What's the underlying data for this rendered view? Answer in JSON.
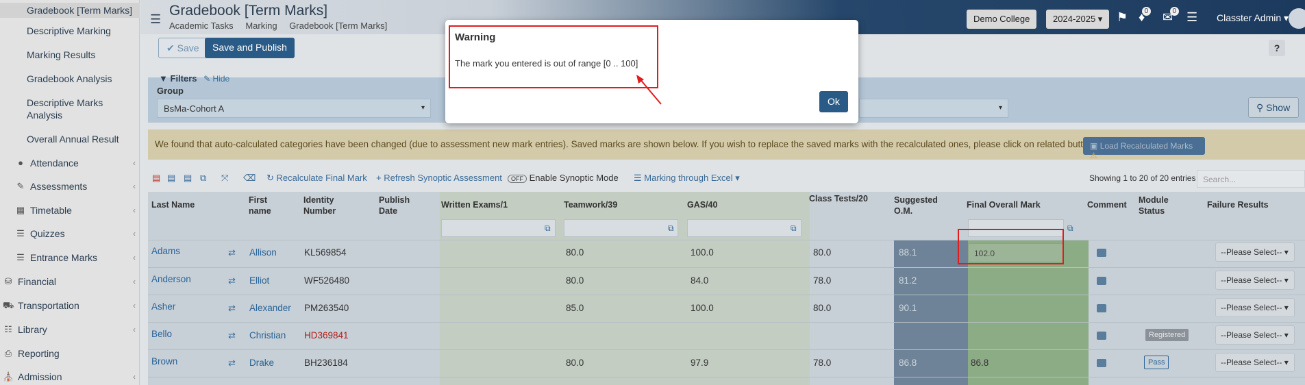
{
  "sidebar": {
    "sub_items": [
      {
        "label": "Gradebook [Term Marks]",
        "active": true
      },
      {
        "label": "Descriptive Marking"
      },
      {
        "label": "Marking Results"
      },
      {
        "label": "Gradebook Analysis"
      },
      {
        "label": "Descriptive Marks Analysis"
      },
      {
        "label": "Overall Annual Result"
      }
    ],
    "items": [
      {
        "label": "Attendance",
        "icon": "user-icon"
      },
      {
        "label": "Assessments",
        "icon": "pencil-icon"
      },
      {
        "label": "Timetable",
        "icon": "calendar-icon"
      },
      {
        "label": "Quizzes",
        "icon": "list-icon"
      },
      {
        "label": "Entrance Marks",
        "icon": "list-icon"
      },
      {
        "label": "Financial",
        "icon": "coins-icon"
      },
      {
        "label": "Transportation",
        "icon": "car-icon"
      },
      {
        "label": "Library",
        "icon": "books-icon"
      },
      {
        "label": "Reporting",
        "icon": "print-icon"
      },
      {
        "label": "Admission",
        "icon": "building-icon"
      }
    ]
  },
  "header": {
    "title": "Gradebook [Term Marks]",
    "breadcrumbs": [
      "Academic Tasks",
      "Marking",
      "Gradebook [Term Marks]"
    ],
    "college": "Demo College",
    "year": "2024-2025",
    "notif_count": "0",
    "mail_count": "0",
    "user": "Classter Admin"
  },
  "toolbar": {
    "save_label": "Save",
    "publish_label": "Save and Publish",
    "help": "?"
  },
  "filters": {
    "title": "Filters",
    "hide": "Hide",
    "group_label": "Group",
    "group_value": "BsMa-Cohort A",
    "show_label": "Show"
  },
  "alert": {
    "text": "We found that auto-calculated categories have been changed (due to assessment new mark entries). Saved marks are shown below. If you wish to replace the saved marks with the recalculated ones, please click on related button.",
    "button": "Load Recalculated Marks"
  },
  "table_toolbar": {
    "recalc": "Recalculate Final Mark",
    "refresh": "Refresh Synoptic Assessment",
    "toggle": "OFF",
    "synoptic": "Enable Synoptic Mode",
    "excel": "Marking through Excel",
    "showing": "Showing 1 to 20 of 20 entries",
    "search_placeholder": "Search..."
  },
  "table": {
    "headers": {
      "last": "Last Name",
      "first": "First name",
      "identity": "Identity Number",
      "publish": "Publish Date",
      "written": "Written Exams/1",
      "teamwork": "Teamwork/39",
      "gas": "GAS/40",
      "class_tests": "Class Tests/20",
      "suggested": "Suggested O.M.",
      "final": "Final Overall Mark",
      "comment": "Comment",
      "module": "Module Status",
      "failure": "Failure Results"
    },
    "rows": [
      {
        "last": "Adams",
        "first": "Allison",
        "id": "KL569854",
        "teamwork": "80.0",
        "gas": "100.0",
        "class_tests": "80.0",
        "suggested": "88.1",
        "final": "102.0",
        "module": "",
        "failure": "--Please Select--"
      },
      {
        "last": "Anderson",
        "first": "Elliot",
        "id": "WF526480",
        "teamwork": "80.0",
        "gas": "84.0",
        "class_tests": "78.0",
        "suggested": "81.2",
        "final": "",
        "module": "",
        "failure": "--Please Select--"
      },
      {
        "last": "Asher",
        "first": "Alexander",
        "id": "PM263540",
        "teamwork": "85.0",
        "gas": "100.0",
        "class_tests": "80.0",
        "suggested": "90.1",
        "final": "",
        "module": "",
        "failure": "--Please Select--"
      },
      {
        "last": "Bello",
        "first": "Christian",
        "id": "HD369841",
        "teamwork": "",
        "gas": "",
        "class_tests": "",
        "suggested": "",
        "final": "",
        "module": "Registered",
        "failure": "--Please Select--"
      },
      {
        "last": "Brown",
        "first": "Drake",
        "id": "BH236184",
        "teamwork": "80.0",
        "gas": "97.9",
        "class_tests": "78.0",
        "suggested": "86.8",
        "final": "86.8",
        "module": "Pass",
        "failure": "--Please Select--"
      }
    ]
  },
  "modal": {
    "title": "Warning",
    "message": "The mark you entered is out of range [0 .. 100]",
    "ok": "Ok"
  }
}
